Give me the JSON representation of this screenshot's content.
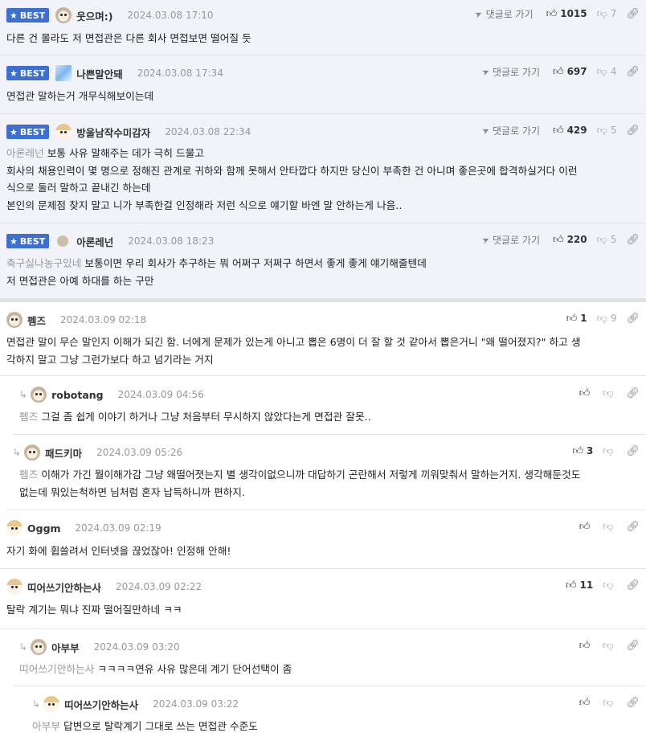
{
  "ui": {
    "best_label": "BEST",
    "reply_link_label": "댓글로 가기"
  },
  "comments": [
    {
      "best": true,
      "nick": "웃으며:)",
      "date": "2024.03.08 17:10",
      "up": "1015",
      "down": "7",
      "mention": "",
      "lines": [
        "다른 건 몰라도 저 면접관은 다른 회사 면접보면 떨어질 듯"
      ]
    },
    {
      "best": true,
      "nick": "나쁜말안돼",
      "date": "2024.03.08 17:34",
      "up": "697",
      "down": "4",
      "mention": "",
      "lines": [
        "면접관 말하는거 개무식해보이는데"
      ]
    },
    {
      "best": true,
      "nick": "방울남작수미감자",
      "date": "2024.03.08 22:34",
      "up": "429",
      "down": "5",
      "mention": "아론레넌",
      "lines": [
        "보통 사유 말해주는 데가 극히 드물고",
        "회사의 채용인력이 몇 명으로 정해진 관계로 귀하와 함께 못해서 안타깝다 하지만 당신이 부족한 건 아니며 좋은곳에 합격하실거다 이런",
        "식으로 둘러 말하고 끝내긴 하는데",
        "본인의 문제점 찾지 말고 니가 부족한걸 인정해라 저런 식으로 얘기할 바엔 말 안하는게 나음.."
      ]
    },
    {
      "best": true,
      "nick": "아론레넌",
      "date": "2024.03.08 18:23",
      "up": "220",
      "down": "5",
      "mention": "축구싫나농구있네",
      "lines": [
        "보통이면 우리 회사가 추구하는 뭐 어쩌구 저쩌구 하면서 좋게 좋게 얘기해줄텐데",
        "저 면접관은 아예 하대를 하는 구만"
      ]
    },
    {
      "best": false,
      "nick": "펨즈",
      "date": "2024.03.09 02:18",
      "up": "1",
      "down": "9",
      "mention": "",
      "lines": [
        "면접관 말이 무슨 말인지 이해가 되긴 함. 너에게 문제가 있는게 아니고 뽑은 6명이 더 잘 할 것 같아서 뽑은거니 \"왜 떨어졌지?\" 하고 생",
        "각하지 말고 그냥 그런가보다 하고 넘기라는 거지"
      ]
    },
    {
      "best": false,
      "nick": "robotang",
      "date": "2024.03.09 04:56",
      "up": "",
      "down": "",
      "mention": "펨즈",
      "lines": [
        "그걸 좀 쉽게 이야기 하거나 그냥 처음부터 무시하지 않았다는게 면접관 잘못.."
      ]
    },
    {
      "best": false,
      "nick": "패드키마",
      "date": "2024.03.09 05:26",
      "up": "3",
      "down": "",
      "mention": "펨즈",
      "lines": [
        "이해가 가긴 뭘이해가감 그냥 왜떨어졋는지 별 생각이없으니까 대답하기 곤란해서 저렇게 끼워맞춰서 말하는거지. 생각해둔것도",
        "없는데 뭐있는척하면 님처럼 혼자 납득하니까 편하지."
      ]
    },
    {
      "best": false,
      "nick": "Oggm",
      "date": "2024.03.09 02:19",
      "up": "",
      "down": "",
      "mention": "",
      "lines": [
        "자기 화에 휩쓸려서 인터넷을 끊었잖아! 인정해 안해!"
      ]
    },
    {
      "best": false,
      "nick": "띠어쓰기안하는사",
      "date": "2024.03.09 02:22",
      "up": "11",
      "down": "",
      "mention": "",
      "lines": [
        "탈락 계기는 뭐냐 진짜 떨어질만하네 ㅋㅋ"
      ]
    },
    {
      "best": false,
      "nick": "아부부",
      "date": "2024.03.09 03:20",
      "up": "",
      "down": "",
      "mention": "띠어쓰기안하는사",
      "lines": [
        "ㅋㅋㅋㅋ연유 사유 많은데 계기 단어선택이 좀"
      ]
    },
    {
      "best": false,
      "nick": "띠어쓰기안하는사",
      "date": "2024.03.09 03:22",
      "up": "",
      "down": "",
      "mention": "아부부",
      "lines": [
        "답변으로 탈락계기 그대로 쓰는 면접관 수준도"
      ]
    }
  ]
}
